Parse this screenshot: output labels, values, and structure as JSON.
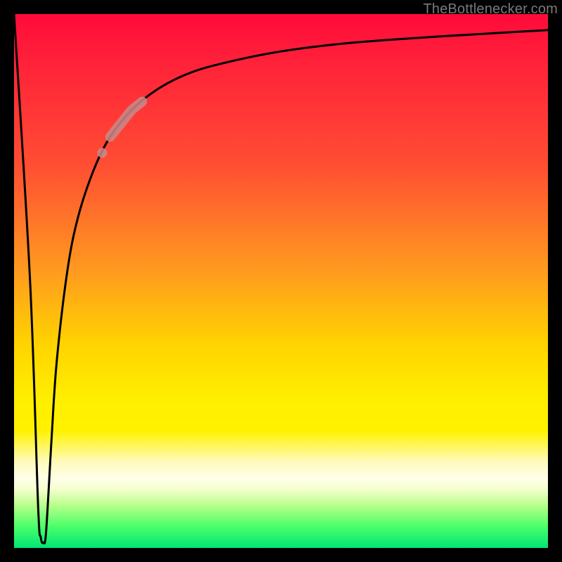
{
  "attribution": "TheBottlenecker.com",
  "colors": {
    "frame": "#000000",
    "curve": "#000000",
    "marker": "#c98a8a",
    "gradient_top": "#ff0a3a",
    "gradient_mid": "#ffee00",
    "gradient_bottom": "#00e676"
  },
  "chart_data": {
    "type": "line",
    "title": "",
    "xlabel": "",
    "ylabel": "",
    "xlim": [
      0,
      100
    ],
    "ylim": [
      0,
      100
    ],
    "grid": false,
    "series": [
      {
        "name": "bottleneck-curve",
        "x": [
          0,
          3,
          4.5,
          5,
          5.5,
          6,
          7,
          8,
          10,
          12,
          15,
          18,
          22,
          27,
          33,
          40,
          50,
          62,
          75,
          88,
          100
        ],
        "values": [
          100,
          50,
          8,
          2,
          1,
          3,
          20,
          35,
          52,
          62,
          71,
          77,
          82,
          86,
          89,
          91,
          93,
          94.5,
          95.5,
          96.3,
          97
        ]
      }
    ],
    "markers": [
      {
        "name": "highlight-segment",
        "x_start": 18,
        "x_end": 24,
        "note": "pale oblong marker on rising limb"
      },
      {
        "name": "highlight-dot",
        "x": 16.5,
        "note": "small pale dot just below segment"
      }
    ]
  }
}
